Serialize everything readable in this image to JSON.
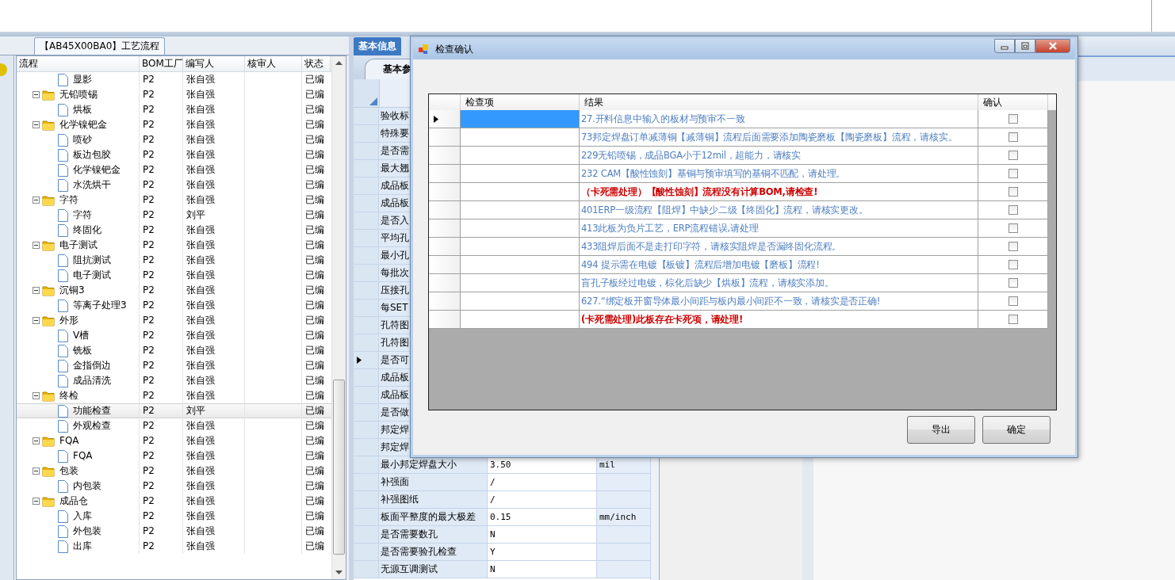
{
  "tree_panel": {
    "title": "【AB45X00BA0】工艺流程",
    "columns": [
      "流程",
      "BOM工厂",
      "编写人",
      "核审人",
      "状态"
    ],
    "orphan_children": [
      {
        "label": "显影",
        "bom": "P2",
        "author": "张自强",
        "status": "已编",
        "selected": false
      }
    ],
    "nodes": [
      {
        "label": "无铅喷锡",
        "bom": "P2",
        "author": "张自强",
        "status": "已编",
        "selected": false,
        "expanded": true,
        "children": [
          {
            "label": "烘板",
            "bom": "P2",
            "author": "张自强",
            "status": "已编",
            "selected": false
          }
        ]
      },
      {
        "label": "化学镍钯金",
        "bom": "P2",
        "author": "张自强",
        "status": "已编",
        "selected": false,
        "expanded": true,
        "children": [
          {
            "label": "喷砂",
            "bom": "P2",
            "author": "张自强",
            "status": "已编",
            "selected": false
          },
          {
            "label": "板边包胶",
            "bom": "P2",
            "author": "张自强",
            "status": "已编",
            "selected": false
          },
          {
            "label": "化学镍钯金",
            "bom": "P2",
            "author": "张自强",
            "status": "已编",
            "selected": false
          },
          {
            "label": "水洗烘干",
            "bom": "P2",
            "author": "张自强",
            "status": "已编",
            "selected": false
          }
        ]
      },
      {
        "label": "字符",
        "bom": "P2",
        "author": "张自强",
        "status": "已编",
        "selected": false,
        "expanded": true,
        "children": [
          {
            "label": "字符",
            "bom": "P2",
            "author": "刘平",
            "status": "已编",
            "selected": false
          },
          {
            "label": "终固化",
            "bom": "P2",
            "author": "张自强",
            "status": "已编",
            "selected": false
          }
        ]
      },
      {
        "label": "电子测试",
        "bom": "P2",
        "author": "张自强",
        "status": "已编",
        "selected": false,
        "expanded": true,
        "children": [
          {
            "label": "阻抗测试",
            "bom": "P2",
            "author": "张自强",
            "status": "已编",
            "selected": false
          },
          {
            "label": "电子测试",
            "bom": "P2",
            "author": "张自强",
            "status": "已编",
            "selected": false
          }
        ]
      },
      {
        "label": "沉铜3",
        "bom": "P2",
        "author": "张自强",
        "status": "已编",
        "selected": false,
        "expanded": true,
        "children": [
          {
            "label": "等离子处理3",
            "bom": "P2",
            "author": "张自强",
            "status": "已编",
            "selected": false
          }
        ]
      },
      {
        "label": "外形",
        "bom": "P2",
        "author": "张自强",
        "status": "已编",
        "selected": false,
        "expanded": true,
        "children": [
          {
            "label": "V槽",
            "bom": "P2",
            "author": "张自强",
            "status": "已编",
            "selected": false
          },
          {
            "label": "铣板",
            "bom": "P2",
            "author": "张自强",
            "status": "已编",
            "selected": false
          },
          {
            "label": "金指倒边",
            "bom": "P2",
            "author": "张自强",
            "status": "已编",
            "selected": false
          },
          {
            "label": "成品清洗",
            "bom": "P2",
            "author": "张自强",
            "status": "已编",
            "selected": false
          }
        ]
      },
      {
        "label": "终检",
        "bom": "P2",
        "author": "张自强",
        "status": "已编",
        "selected": false,
        "expanded": true,
        "children": [
          {
            "label": "功能检查",
            "bom": "P2",
            "author": "刘平",
            "status": "已编",
            "selected": true
          },
          {
            "label": "外观检查",
            "bom": "P2",
            "author": "张自强",
            "status": "已编",
            "selected": false
          }
        ]
      },
      {
        "label": "FQA",
        "bom": "P2",
        "author": "张自强",
        "status": "已编",
        "selected": false,
        "expanded": true,
        "children": [
          {
            "label": "FQA",
            "bom": "P2",
            "author": "张自强",
            "status": "已编",
            "selected": false
          }
        ]
      },
      {
        "label": "包装",
        "bom": "P2",
        "author": "张自强",
        "status": "已编",
        "selected": false,
        "expanded": true,
        "children": [
          {
            "label": "内包装",
            "bom": "P2",
            "author": "张自强",
            "status": "已编",
            "selected": false
          }
        ]
      },
      {
        "label": "成品仓",
        "bom": "P2",
        "author": "张自强",
        "status": "已编",
        "selected": false,
        "expanded": true,
        "children": [
          {
            "label": "入库",
            "bom": "P2",
            "author": "张自强",
            "status": "已编",
            "selected": false
          },
          {
            "label": "外包装",
            "bom": "P2",
            "author": "张自强",
            "status": "已编",
            "selected": false
          },
          {
            "label": "出库",
            "bom": "P2",
            "author": "张自强",
            "status": "已编",
            "selected": false
          }
        ]
      }
    ]
  },
  "form_panel": {
    "tabs": [
      {
        "label": "基本信息",
        "selected": true
      }
    ],
    "subtabs": [
      {
        "label": "基本参",
        "selected": true
      }
    ],
    "rows": [
      {
        "label": "验收标",
        "selected": false
      },
      {
        "label": "特殊要",
        "selected": false
      },
      {
        "label": "是否需",
        "selected": false
      },
      {
        "label": "最大翘",
        "selected": false
      },
      {
        "label": "成品板",
        "selected": false
      },
      {
        "label": "成品板",
        "selected": false
      },
      {
        "label": "是否入",
        "selected": false
      },
      {
        "label": "平均孔",
        "selected": false
      },
      {
        "label": "最小孔",
        "selected": false
      },
      {
        "label": "每批次",
        "selected": false
      },
      {
        "label": "压接孔",
        "selected": false
      },
      {
        "label": "每SET",
        "selected": false
      },
      {
        "label": "孔符图",
        "selected": false
      },
      {
        "label": "孔符图",
        "selected": false
      },
      {
        "label": "是否可",
        "selected": true
      },
      {
        "label": "成品板",
        "selected": false
      },
      {
        "label": "成品板",
        "selected": false
      },
      {
        "label": "是否做",
        "selected": false
      },
      {
        "label": "邦定焊",
        "selected": false
      },
      {
        "label": "邦定焊",
        "selected": false
      },
      {
        "label": "最小邦定焊盘大小",
        "value": "3.50",
        "unit": "mil",
        "selected": false
      },
      {
        "label": "补强面",
        "value": "/",
        "selected": false
      },
      {
        "label": "补强图纸",
        "value": "/",
        "selected": false
      },
      {
        "label": "板面平整度的最大极差",
        "value": "0.15",
        "unit": "mm/inch",
        "selected": false
      },
      {
        "label": "是否需要数孔",
        "value": "N",
        "selected": false
      },
      {
        "label": "是否需要验孔检查",
        "value": "Y",
        "selected": false
      },
      {
        "label": "无源互调测试",
        "value": "N",
        "selected": false
      }
    ]
  },
  "dialog": {
    "title": "检查确认",
    "columns": [
      "检查项",
      "结果",
      "确认"
    ],
    "rows": [
      {
        "result": "27.开料信息中输入的板材与预审不一致",
        "kind": "note",
        "confirmed": false,
        "selected": true
      },
      {
        "result": "73邦定焊盘订单减薄铜【减薄铜】流程后面需要添加陶瓷磨板【陶瓷磨板】流程，请核实。",
        "kind": "note",
        "confirmed": false,
        "selected": false
      },
      {
        "result": "229无铅喷锡，成品BGA小于12mil，超能力，请核实",
        "kind": "note",
        "confirmed": false,
        "selected": false
      },
      {
        "result": "232 CAM【酸性蚀刻】基铜与预审填写的基铜不匹配，请处理。",
        "kind": "note",
        "confirmed": false,
        "selected": false
      },
      {
        "result": "（卡死需处理）【酸性蚀刻】流程没有计算BOM,请检查!",
        "kind": "blocking",
        "confirmed": false,
        "selected": false
      },
      {
        "result": "401ERP一级流程【阻焊】中缺少二级【终固化】流程，请核实更改。",
        "kind": "note",
        "confirmed": false,
        "selected": false
      },
      {
        "result": "413此板为负片工艺，ERP流程错误,请处理",
        "kind": "note",
        "confirmed": false,
        "selected": false
      },
      {
        "result": "433阻焊后面不是走打印字符，请核实阻焊是否漏终固化流程。",
        "kind": "note",
        "confirmed": false,
        "selected": false
      },
      {
        "result": "494 提示需在电镀【板镀】流程后增加电镀【磨板】流程!",
        "kind": "note",
        "confirmed": false,
        "selected": false
      },
      {
        "result": "盲孔子板经过电镀，棕化后缺少【烘板】流程，请核实添加。",
        "kind": "note",
        "confirmed": false,
        "selected": false
      },
      {
        "result": "627.“绑定板开窗导体最小间距与板内最小间距不一致，请核实是否正确!",
        "kind": "note",
        "confirmed": false,
        "selected": false
      },
      {
        "result": "(卡死需处理)此板存在卡死项，请处理!",
        "kind": "blocking",
        "confirmed": false,
        "selected": false
      }
    ],
    "buttons": [
      "导出",
      "确定"
    ]
  }
}
